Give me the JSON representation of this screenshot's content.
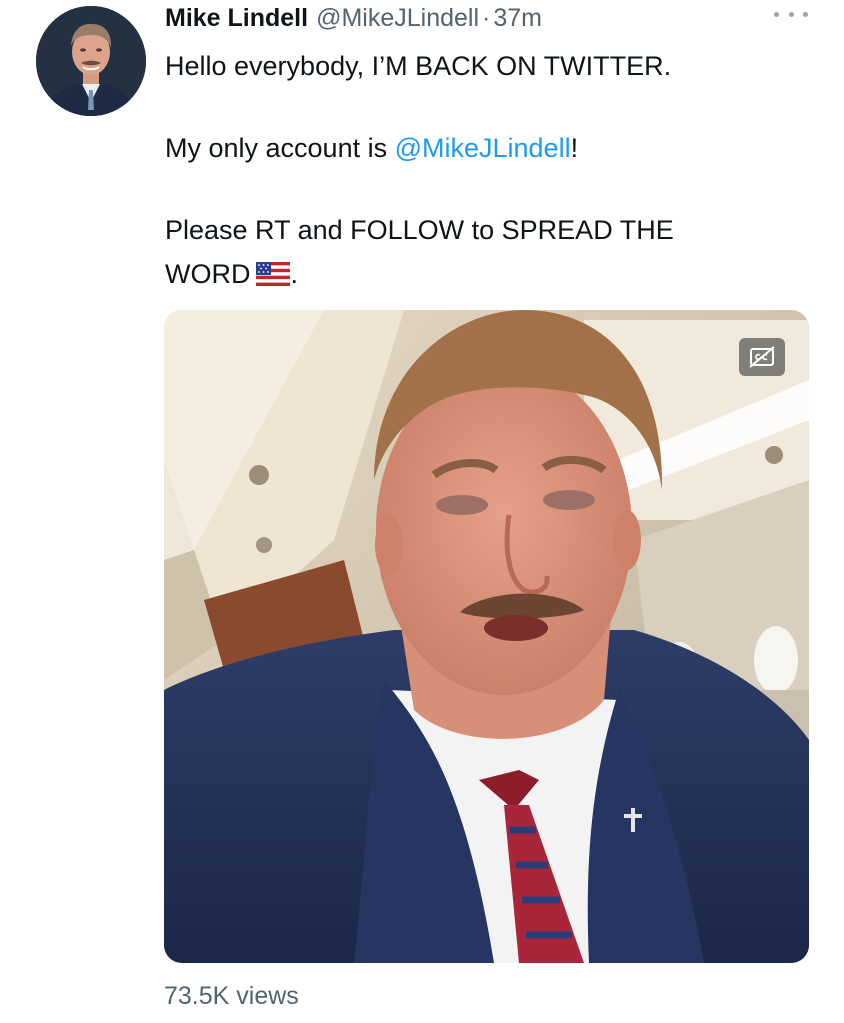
{
  "tweet": {
    "author_name": "Mike Lindell",
    "handle": "@MikeJLindell",
    "separator": "·",
    "time": "37m",
    "line1": "Hello everybody, I’M BACK ON TWITTER.",
    "line2_prefix": "My only account is ",
    "line2_mention": "@MikeJLindell",
    "line2_suffix": "!",
    "line3": "Please RT and FOLLOW to SPREAD THE",
    "line4_text": "WORD",
    "line4_suffix": ".",
    "views": "73.5K views"
  },
  "icons": {
    "more": "more-options-icon",
    "flag": "us-flag-emoji",
    "captions": "closed-captions-off-icon"
  },
  "colors": {
    "link": "#1d9bf0",
    "secondary_text": "#536471",
    "primary_text": "#0f1419"
  }
}
